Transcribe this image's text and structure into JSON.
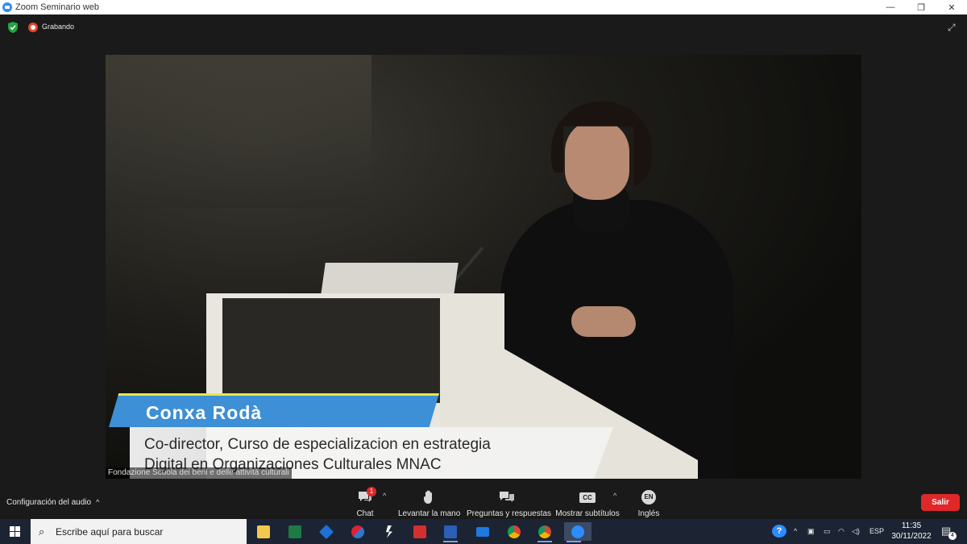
{
  "window": {
    "title": "Zoom Seminario web",
    "controls": [
      "minimize-icon",
      "restore-icon",
      "close-icon"
    ]
  },
  "top_bar": {
    "security_icon": "shield-icon",
    "recording_label": "Grabando",
    "expand_icon": "fullscreen-icon"
  },
  "video": {
    "speaker_name": "Conxa Rodà",
    "caption_line1": "Co-director, Curso de especializacion en estrategia",
    "caption_line2": "Digital en Organizaciones Culturales MNAC",
    "participant_label": "Fondazione Scuola dei beni e delle attività culturali"
  },
  "controls": {
    "audio_settings": "Configuración del audio",
    "chat": {
      "label": "Chat",
      "badge": "1"
    },
    "raise_hand": "Levantar la mano",
    "qa": "Preguntas y respuestas",
    "captions": {
      "label": "Mostrar subtítulos",
      "icon_text": "CC"
    },
    "language": {
      "label": "Inglés",
      "icon_text": "EN"
    },
    "leave": "Salir"
  },
  "taskbar": {
    "search_placeholder": "Escribe aquí para buscar",
    "apps": [
      "file-explorer",
      "excel",
      "dropbox",
      "app-red-blue",
      "app-s",
      "acrobat",
      "word",
      "mail",
      "chrome",
      "chrome",
      "zoom"
    ],
    "tray": {
      "language": "ESP",
      "time": "11:35",
      "date": "30/11/2022",
      "notifications": "4"
    }
  },
  "colors": {
    "accent_blue": "#2d8cff",
    "leave_red": "#e02828",
    "lower_third_blue": "#3d8fd6",
    "lower_third_yellow": "#e8e847"
  }
}
